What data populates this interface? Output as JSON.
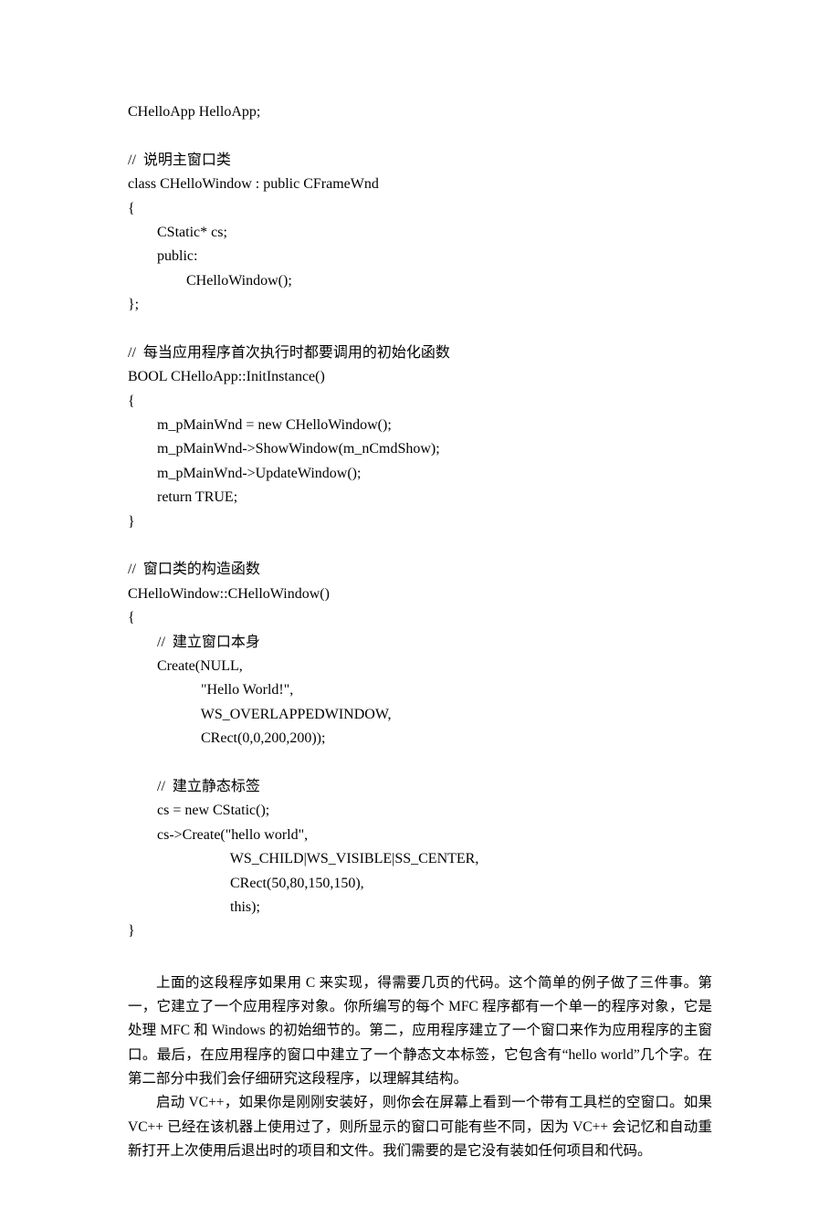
{
  "code": {
    "l1": "CHelloApp HelloApp;",
    "l2": "//  说明主窗口类",
    "l3": "class CHelloWindow : public CFrameWnd",
    "l4": "{",
    "l5": "        CStatic* cs;",
    "l6": "        public:",
    "l7": "                CHelloWindow();",
    "l8": "};",
    "l9": "//  每当应用程序首次执行时都要调用的初始化函数",
    "l10": "BOOL CHelloApp::InitInstance()",
    "l11": "{",
    "l12": "        m_pMainWnd = new CHelloWindow();",
    "l13": "        m_pMainWnd->ShowWindow(m_nCmdShow);",
    "l14": "        m_pMainWnd->UpdateWindow();",
    "l15": "        return TRUE;",
    "l16": "}",
    "l17": "//  窗口类的构造函数",
    "l18": "CHelloWindow::CHelloWindow()",
    "l19": "{",
    "l20": "        //  建立窗口本身",
    "l21": "        Create(NULL,",
    "l22": "                    \"Hello World!\",",
    "l23": "                    WS_OVERLAPPEDWINDOW,",
    "l24": "                    CRect(0,0,200,200));",
    "l25": "        //  建立静态标签",
    "l26": "        cs = new CStatic();",
    "l27": "        cs->Create(\"hello world\",",
    "l28": "                            WS_CHILD|WS_VISIBLE|SS_CENTER,",
    "l29": "                            CRect(50,80,150,150),",
    "l30": "                            this);",
    "l31": "}"
  },
  "paragraphs": {
    "p1": "上面的这段程序如果用 C 来实现，得需要几页的代码。这个简单的例子做了三件事。第一，它建立了一个应用程序对象。你所编写的每个 MFC 程序都有一个单一的程序对象，它是处理 MFC 和 Windows 的初始细节的。第二，应用程序建立了一个窗口来作为应用程序的主窗口。最后，在应用程序的窗口中建立了一个静态文本标签，它包含有“hello world”几个字。在第二部分中我们会仔细研究这段程序，以理解其结构。",
    "p2": "启动 VC++，如果你是刚刚安装好，则你会在屏幕上看到一个带有工具栏的空窗口。如果 VC++ 已经在该机器上使用过了，则所显示的窗口可能有些不同，因为 VC++ 会记忆和自动重新打开上次使用后退出时的项目和文件。我们需要的是它没有装如任何项目和代码。"
  }
}
